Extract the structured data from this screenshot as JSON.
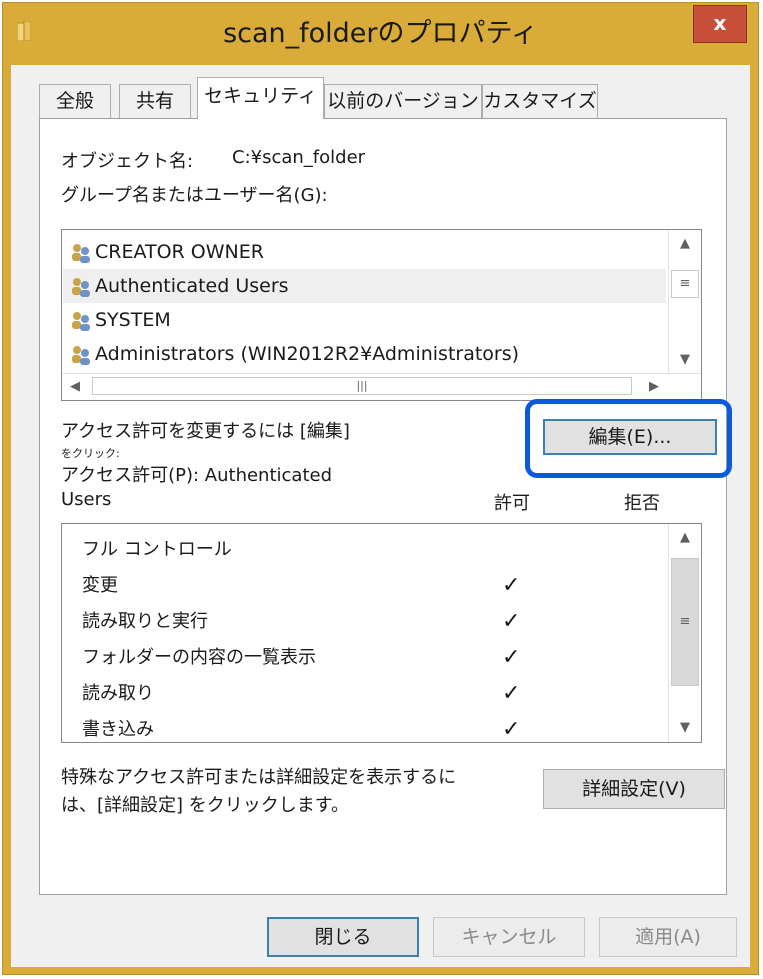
{
  "window": {
    "title": "scan_folderのプロパティ",
    "close_label": "x"
  },
  "tabs": [
    {
      "label": "全般",
      "active": false
    },
    {
      "label": "共有",
      "active": false
    },
    {
      "label": "セキュリティ",
      "active": true
    },
    {
      "label": "以前のバージョン",
      "active": false
    },
    {
      "label": "カスタマイズ",
      "active": false
    }
  ],
  "security": {
    "object_label": "オブジェクト名:",
    "object_value": "C:¥scan_folder",
    "groups_label": "グループ名またはユーザー名(G):",
    "groups": [
      {
        "name": "CREATOR OWNER",
        "selected": false
      },
      {
        "name": "Authenticated Users",
        "selected": true
      },
      {
        "name": "SYSTEM",
        "selected": false
      },
      {
        "name": "Administrators (WIN2012R2¥Administrators)",
        "selected": false
      }
    ],
    "change_hint_1": "アクセス許可を変更するには [編集]",
    "change_hint_2": "をクリック:",
    "edit_button": "編集(E)...",
    "perm_for_1": "アクセス許可(P): Authenticated",
    "perm_for_2": "Users",
    "allow_header": "許可",
    "deny_header": "拒否",
    "permissions": [
      {
        "name": "フル コントロール",
        "allow": false,
        "deny": false
      },
      {
        "name": "変更",
        "allow": true,
        "deny": false
      },
      {
        "name": "読み取りと実行",
        "allow": true,
        "deny": false
      },
      {
        "name": "フォルダーの内容の一覧表示",
        "allow": true,
        "deny": false
      },
      {
        "name": "読み取り",
        "allow": true,
        "deny": false
      },
      {
        "name": "書き込み",
        "allow": true,
        "deny": false
      }
    ],
    "check_glyph": "✓",
    "advanced_hint_1": "特殊なアクセス許可または詳細設定を表示するに",
    "advanced_hint_2": "は、[詳細設定] をクリックします。",
    "advanced_button": "詳細設定(V)"
  },
  "footer": {
    "close_button": "閉じる",
    "cancel_button": "キャンセル",
    "apply_button": "適用(A)"
  },
  "colors": {
    "titlebar": "#d9ab39",
    "close_button": "#c7503b",
    "highlight": "#0a5bdc"
  },
  "icons": {
    "folder": "folder-icon",
    "users": "user-group-icon",
    "close": "close-icon"
  }
}
